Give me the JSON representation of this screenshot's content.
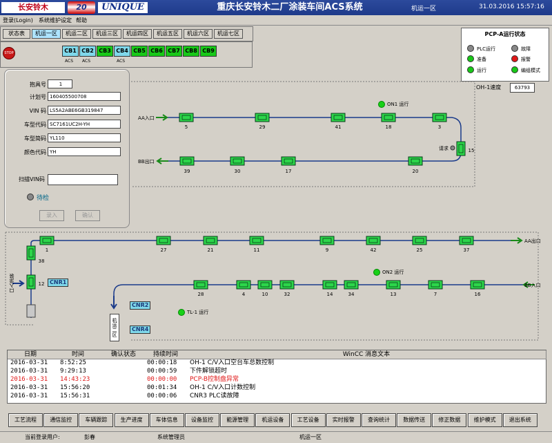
{
  "header": {
    "logo1": "长安铃木",
    "logo2": "20",
    "logo3": "UNIQUE",
    "title": "重庆长安铃木二厂涂装车间ACS系统",
    "area": "机运一区",
    "datetime": "31.03.2016 15:57:16"
  },
  "menu": [
    "登录(Login)",
    "系统维护设定",
    "帮助"
  ],
  "tabs": [
    "状态表",
    "机运一区",
    "机运二区",
    "机运三区",
    "机运四区",
    "机运五区",
    "机运六区",
    "机运七区"
  ],
  "cb": {
    "stop": "STOP",
    "items": [
      {
        "label": "CB1",
        "color": "#7fd8ea",
        "acs": "ACS"
      },
      {
        "label": "CB2",
        "color": "#7fd8ea",
        "acs": "ACS"
      },
      {
        "label": "CB3",
        "color": "#18c818",
        "acs": ""
      },
      {
        "label": "CB4",
        "color": "#7fd8ea",
        "acs": "ACS"
      },
      {
        "label": "CB5",
        "color": "#18c818",
        "acs": ""
      },
      {
        "label": "CB6",
        "color": "#18c818",
        "acs": ""
      },
      {
        "label": "CB7",
        "color": "#18c818",
        "acs": ""
      },
      {
        "label": "CB8",
        "color": "#18c818",
        "acs": ""
      },
      {
        "label": "CB9",
        "color": "#18c818",
        "acs": ""
      }
    ]
  },
  "legend": {
    "title": "PCP-A运行状态",
    "items": [
      {
        "label": "PLC运行",
        "color": "#888888"
      },
      {
        "label": "故障",
        "color": "#888888"
      },
      {
        "label": "准备",
        "color": "#18c818"
      },
      {
        "label": "报警",
        "color": "#e01818"
      },
      {
        "label": "运行",
        "color": "#18c818"
      },
      {
        "label": "编组模式",
        "color": "#18c818"
      }
    ]
  },
  "info": {
    "fields": [
      {
        "label": "抱具号",
        "value": "1"
      },
      {
        "label": "计划号",
        "value": "160405500708"
      },
      {
        "label": "VIN 码",
        "value": "LS5A2ABE6GB319847"
      },
      {
        "label": "车型代码",
        "value": "SC7161UC2H-YH"
      },
      {
        "label": "车型简码",
        "value": "YL110"
      },
      {
        "label": "颜色代码",
        "value": "YH"
      }
    ],
    "scan_label": "扫描VIN码",
    "scan_value": "",
    "status": "待检",
    "btn_input": "录入",
    "btn_confirm": "确认"
  },
  "speed": {
    "label": "OH-1速度",
    "value": "63793"
  },
  "process": {
    "aa_in": "AA入口",
    "bb_out": "BB出口",
    "aa_out": "AA出口",
    "bb_in": "BB入口",
    "on1": "ON1 运行",
    "on2": "ON2 运行",
    "tl1": "TL-1 运行",
    "request": "请求",
    "side_label": "口入涂装",
    "vert_label": "机运二区",
    "top_row": [
      "5",
      "29",
      "41",
      "18",
      "3"
    ],
    "second_row": [
      "39",
      "30",
      "17",
      "20"
    ],
    "third_row": [
      "1",
      "27",
      "21",
      "11",
      "9",
      "42",
      "25",
      "37"
    ],
    "fourth_row": [
      "28",
      "4",
      "10",
      "32",
      "14",
      "34",
      "13",
      "7",
      "16"
    ],
    "carrier_15": "15",
    "carrier_38": "38",
    "carrier_12": "12",
    "cnr": [
      "CNR1",
      "CNR2",
      "CNR4"
    ]
  },
  "messages": {
    "headers": [
      "日期",
      "时间",
      "确认状态",
      "持续时间",
      "WinCC 消息文本"
    ],
    "rows": [
      {
        "date": "2016-03-31",
        "time": "8:52:25",
        "ack": "",
        "dur": "00:00:18",
        "text": "OH-1 C/V入口空台车总数控制",
        "color": "#000000"
      },
      {
        "date": "2016-03-31",
        "time": "9:29:13",
        "ack": "",
        "dur": "00:00:59",
        "text": "下件解锁超时",
        "color": "#000000"
      },
      {
        "date": "2016-03-31",
        "time": "14:43:23",
        "ack": "",
        "dur": "00:00:00",
        "text": "PCP-B控制盘异常",
        "color": "#e01818"
      },
      {
        "date": "2016-03-31",
        "time": "15:56:20",
        "ack": "",
        "dur": "00:01:34",
        "text": "OH-1 C/V入口计数控制",
        "color": "#000000"
      },
      {
        "date": "2016-03-31",
        "time": "15:56:31",
        "ack": "",
        "dur": "00:00:06",
        "text": "CNR3 PLC读故障",
        "color": "#000000"
      }
    ]
  },
  "bottom": [
    "工艺流程",
    "通信监控",
    "车辆跟踪",
    "生产进度",
    "车体信息",
    "设备监控",
    "能源管理",
    "机运设备",
    "工艺设备",
    "实时报警",
    "查询统计",
    "数据传送",
    "修正数据",
    "维护模式",
    "退出系统"
  ],
  "status": {
    "user_label": "当前登录用户:",
    "user": "彭春",
    "role": "系统管理员",
    "area": "机运一区"
  }
}
